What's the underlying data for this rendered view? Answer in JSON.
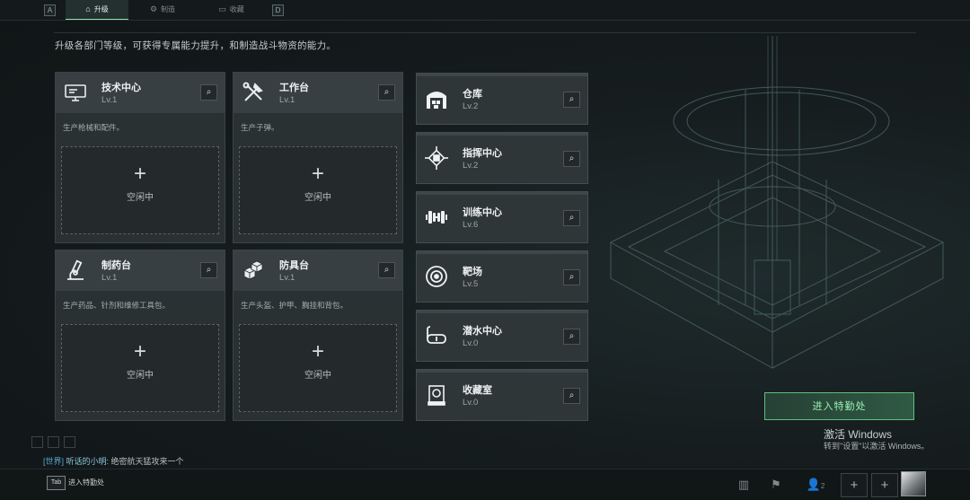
{
  "topbar": {
    "left_key": "A",
    "right_key": "D",
    "tabs": [
      {
        "label": "升级",
        "icon": "upgrade-icon",
        "active": true
      },
      {
        "label": "制造",
        "icon": "craft-icon",
        "active": false
      },
      {
        "label": "收藏",
        "icon": "collection-icon",
        "active": false
      }
    ]
  },
  "description": "升级各部门等级，可获得专属能力提升，和制造战斗物资的能力。",
  "cards": [
    {
      "title": "技术中心",
      "level": "Lv.1",
      "desc": "生产枪械和配件。",
      "slot_label": "空闲中",
      "icon": "tech-center-icon"
    },
    {
      "title": "工作台",
      "level": "Lv.1",
      "desc": "生产子弹。",
      "slot_label": "空闲中",
      "icon": "workbench-icon"
    },
    {
      "title": "制药台",
      "level": "Lv.1",
      "desc": "生产药品、针剂和维修工具包。",
      "slot_label": "空闲中",
      "icon": "pharmacy-icon"
    },
    {
      "title": "防具台",
      "level": "Lv.1",
      "desc": "生产头盔、护甲、胸挂和背包。",
      "slot_label": "空闲中",
      "icon": "armor-bench-icon"
    }
  ],
  "facilities": [
    {
      "title": "仓库",
      "level": "Lv.2",
      "icon": "warehouse-icon"
    },
    {
      "title": "指挥中心",
      "level": "Lv.2",
      "icon": "command-center-icon"
    },
    {
      "title": "训练中心",
      "level": "Lv.6",
      "icon": "training-icon"
    },
    {
      "title": "靶场",
      "level": "Lv.5",
      "icon": "target-range-icon"
    },
    {
      "title": "潜水中心",
      "level": "Lv.0",
      "icon": "diving-icon"
    },
    {
      "title": "收藏室",
      "level": "Lv.0",
      "icon": "collection-room-icon"
    }
  ],
  "enter_button": "进入特勤处",
  "watermark": {
    "line1": "激活 Windows",
    "line2": "转到\"设置\"以激活 Windows。"
  },
  "chat": {
    "channel": "[世界]",
    "name": "听话的小明",
    "message": ": 绝密航天猛攻来一个"
  },
  "bottom": {
    "key": "Tab",
    "label": "进入特勤处",
    "friends_count": "2"
  },
  "colors": {
    "accent": "#5fbf7f",
    "panel": "#2a3133",
    "header": "#383f42"
  }
}
